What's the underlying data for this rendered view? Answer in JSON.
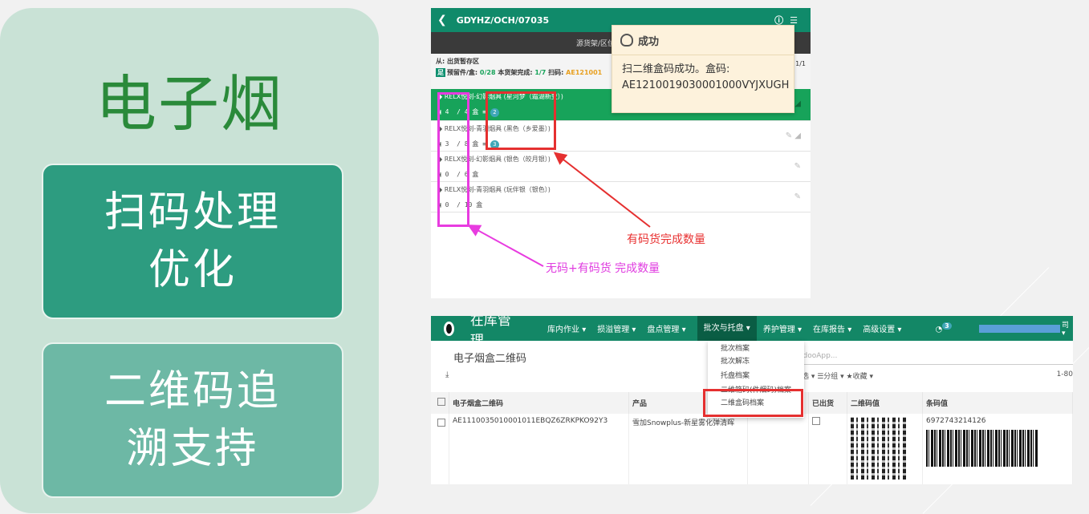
{
  "left": {
    "title": "电子烟",
    "card1": [
      "扫码处理",
      "优化"
    ],
    "card2": [
      "二维码追",
      "溯支持"
    ]
  },
  "phone": {
    "header_title": "GDYHZ/OCH/07035",
    "notice": "源货架/区位已确认，请扫描",
    "from_label": "从: 出货暂存区",
    "badge": "足",
    "stats_label": "预留件/盒: ",
    "stats_reserved": "0/28",
    "stats_done_label": " 本货架完成: ",
    "stats_done": "1/7",
    "scan_label": " 扫码: ",
    "scan_value": "AE121001",
    "page": "1/1",
    "items": [
      {
        "name": "RELX悦刻-幻影烟具 (星河梦（霜湖新变）)",
        "qty": "4",
        "total": "/ 4",
        "unit": "盒",
        "scanned": "2"
      },
      {
        "name": "RELX悦刻-青羽烟具 (黑色（乡爱墨）)",
        "qty": "3",
        "total": "/ 8",
        "unit": "盒",
        "scanned": "3"
      },
      {
        "name": "RELX悦刻-幻影烟具 (银色（皎月银）)",
        "qty": "0",
        "total": "/ 6",
        "unit": "盒"
      },
      {
        "name": "RELX悦刻-青羽烟具 (玩伴银（银色）)",
        "qty": "0",
        "total": "/ 10",
        "unit": "盒"
      }
    ],
    "toast_title": "成功",
    "toast_line1": "扫二维盒码成功。盒码:",
    "toast_line2": "AE1210019030001000VYJXUGH"
  },
  "annotations": {
    "red_label": "有码货完成数量",
    "magenta_label": "无码+有码货 完成数量"
  },
  "desktop": {
    "app_title": "在库管理",
    "menus": [
      "库内作业 ▾",
      "损溢管理 ▾",
      "盘点管理 ▾",
      "批次与托盘 ▾",
      "养护管理 ▾",
      "在库报告 ▾",
      "高级设置 ▾"
    ],
    "msg_count": "3",
    "user_suffix": "司 ▾",
    "breadcrumb": "电子烟盒二维码",
    "search_placeholder": "odooApp...",
    "filters": "选 ▾ ☰分组 ▾ ★收藏 ▾",
    "pager": "1-80",
    "dropdown": [
      "批次档案",
      "批次解冻",
      "托盘档案",
      "二维箱码(件烟码)档案",
      "二维盒码档案"
    ],
    "columns": [
      "电子烟盒二维码",
      "产品",
      "",
      "已出货",
      "二维码值",
      "条码值"
    ],
    "row": {
      "code": "AE1110035010001011EBQZ6ZRKPKO92Y3",
      "product": "雪加Snowplus-新星雾化弹清晖",
      "barcode": "6972743214126"
    }
  }
}
